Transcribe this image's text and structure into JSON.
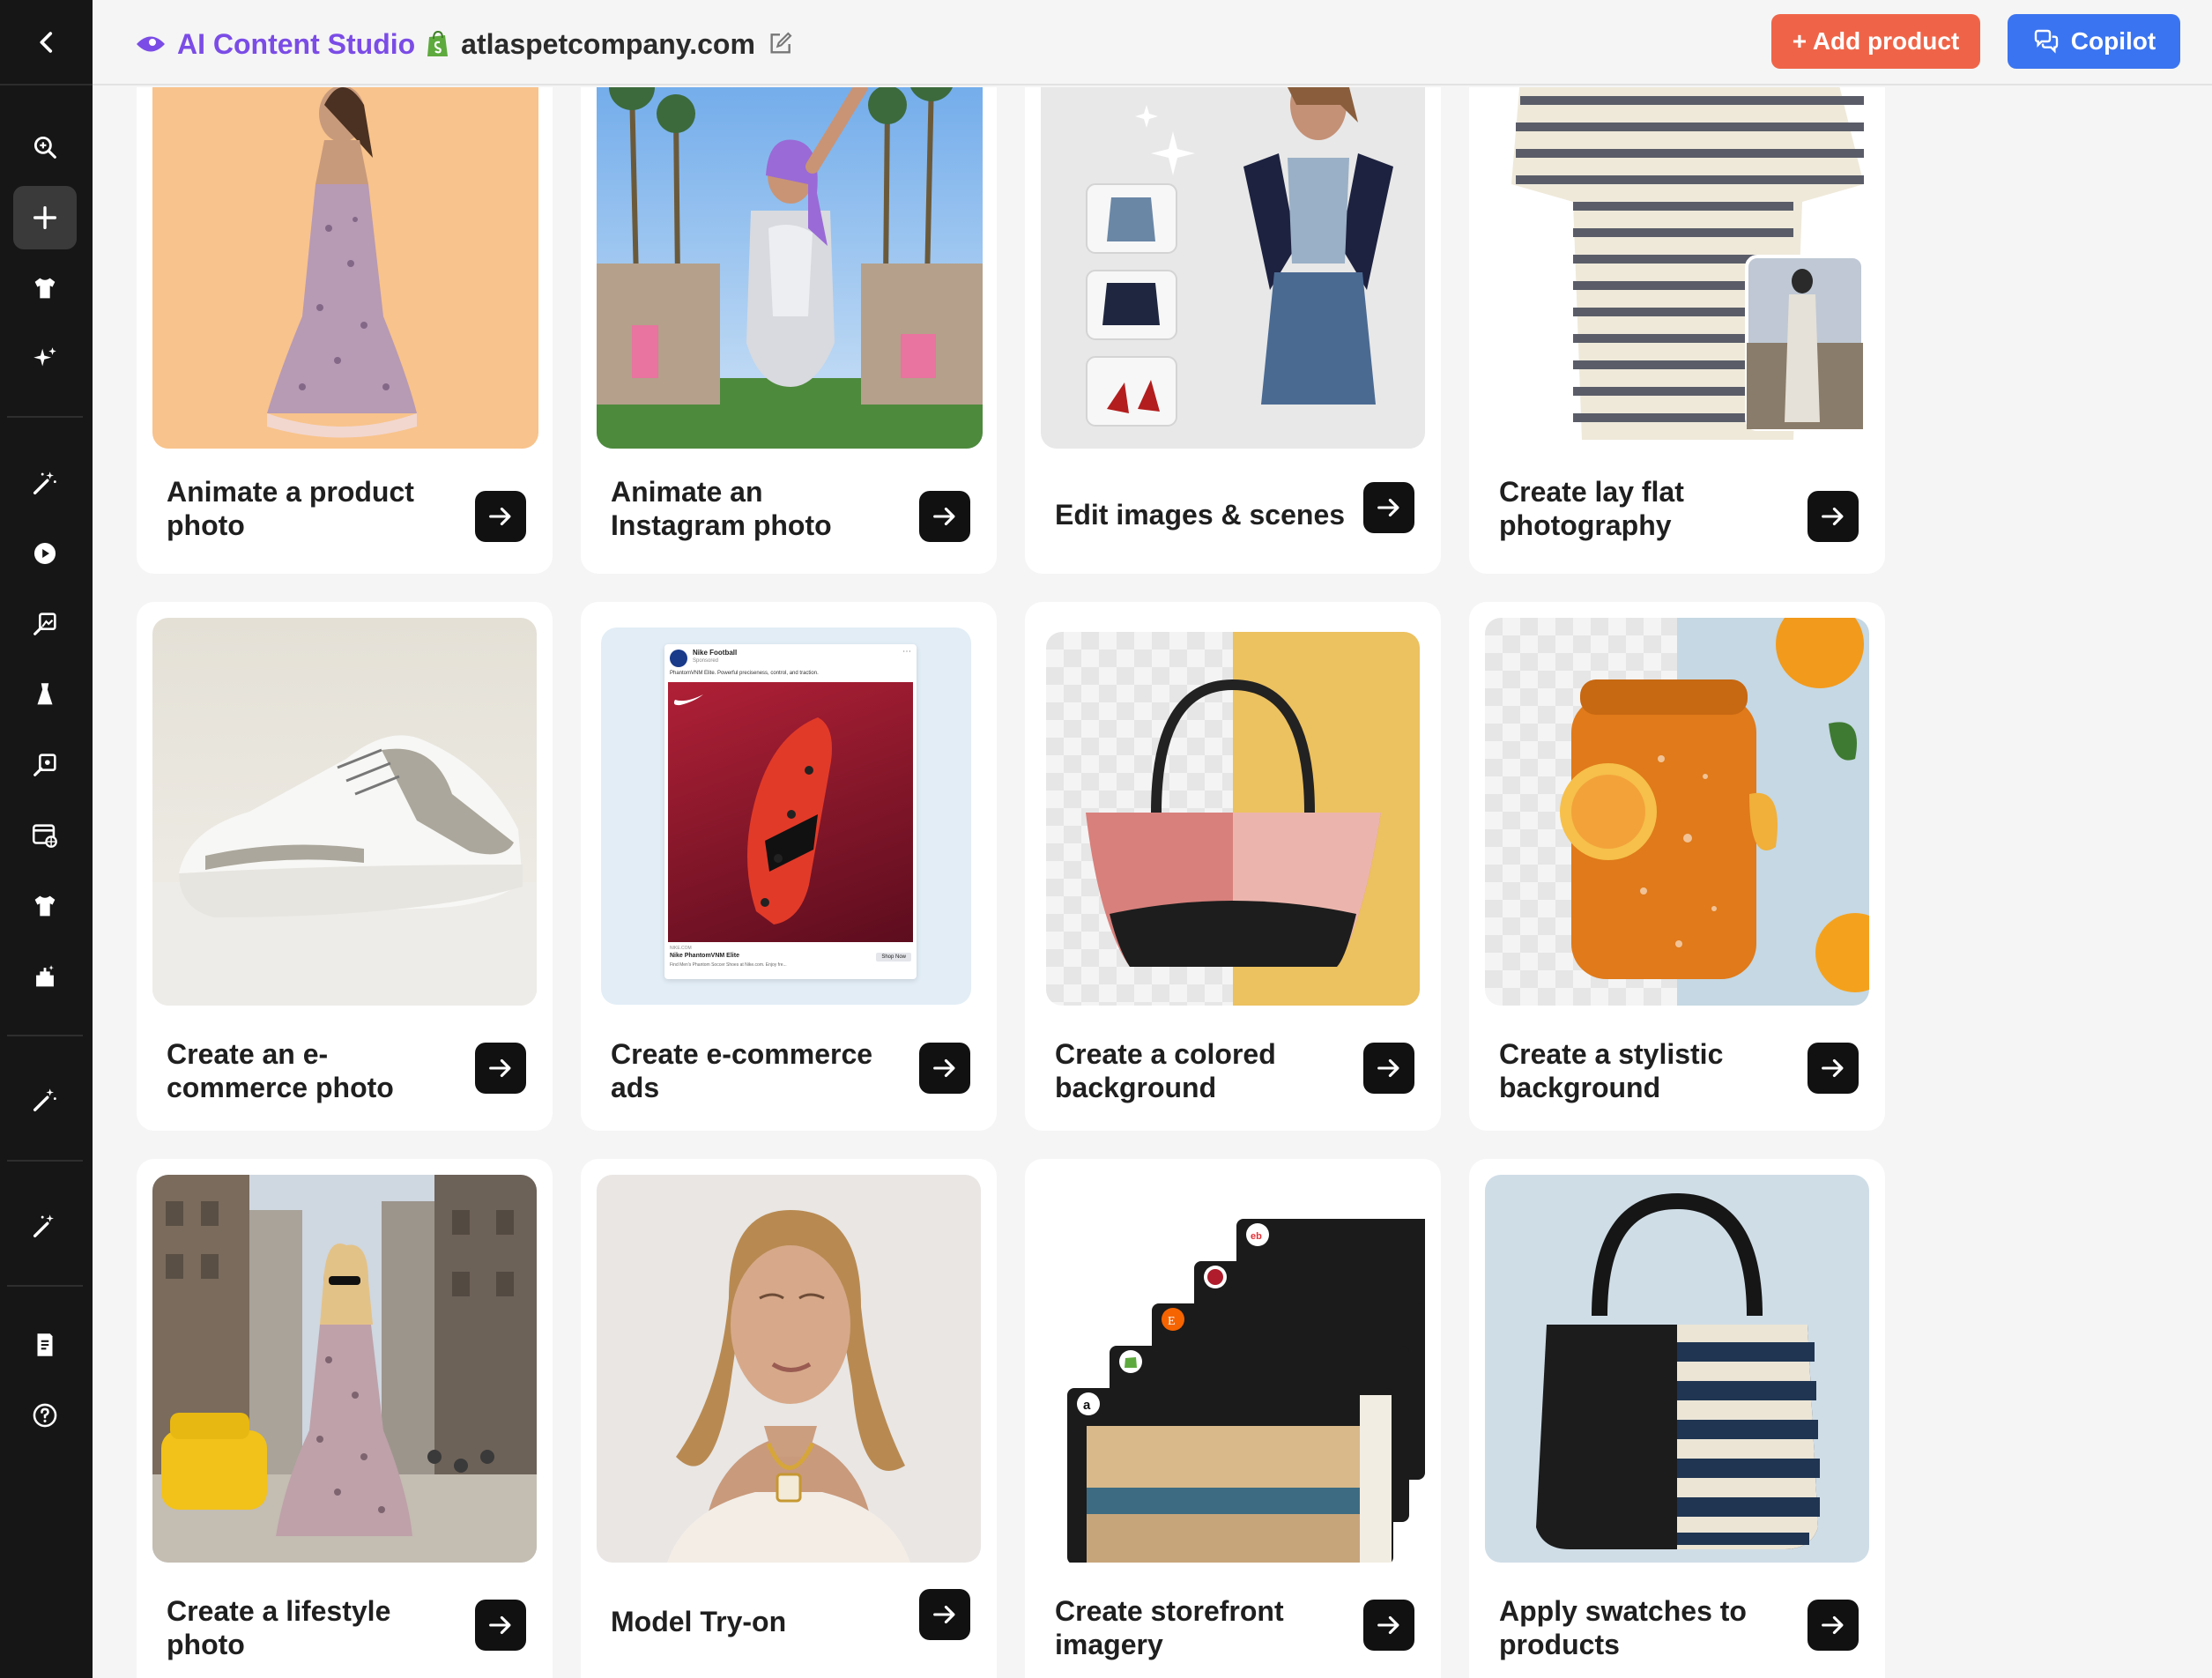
{
  "header": {
    "brand_title": "AI Content Studio",
    "store_name": "atlaspetcompany.com",
    "add_product_label": "+ Add product",
    "copilot_label": "Copilot"
  },
  "sidebar": {
    "items": [
      {
        "icon": "search-zoom-icon"
      },
      {
        "icon": "plus-icon",
        "active": true
      },
      {
        "icon": "shirt-icon"
      },
      {
        "icon": "sparkles-icon"
      },
      {
        "icon": "magic-wand-icon"
      },
      {
        "icon": "play-icon"
      },
      {
        "icon": "image-edit-icon"
      },
      {
        "icon": "dress-icon"
      },
      {
        "icon": "image-edit-icon"
      },
      {
        "icon": "web-icon"
      },
      {
        "icon": "shirt-icon"
      },
      {
        "icon": "castle-icon"
      },
      {
        "icon": "magic-wand-icon"
      },
      {
        "icon": "magic-wand-icon"
      },
      {
        "icon": "document-icon"
      },
      {
        "icon": "help-icon"
      }
    ]
  },
  "cards": [
    {
      "label": "Animate a product photo"
    },
    {
      "label": "Animate an Instagram photo"
    },
    {
      "label": "Edit images & scenes"
    },
    {
      "label": "Create lay flat photography"
    },
    {
      "label": "Create an e-commerce photo"
    },
    {
      "label": "Create e-commerce ads"
    },
    {
      "label": "Create a colored background"
    },
    {
      "label": "Create a stylistic background"
    },
    {
      "label": "Create a lifestyle photo"
    },
    {
      "label": "Model Try-on"
    },
    {
      "label": "Create storefront imagery"
    },
    {
      "label": "Apply swatches to products"
    }
  ],
  "ad_preview": {
    "account": "Nike Football",
    "sponsored": "Sponsored",
    "caption": "PhantomVNM Elite. Powerful preciseness, control, and traction.",
    "domain": "NIKE.COM",
    "product": "Nike PhantomVNM Elite",
    "description": "Find Men's Phantom Soccer Shoes at Nike.com. Enjoy fre...",
    "cta": "Shop Now"
  },
  "colors": {
    "sidebar_bg": "#161616",
    "brand_purple": "#7b4ce6",
    "add_product": "#ef6448",
    "copilot": "#3b74f0",
    "page_bg": "#f5f5f5"
  }
}
